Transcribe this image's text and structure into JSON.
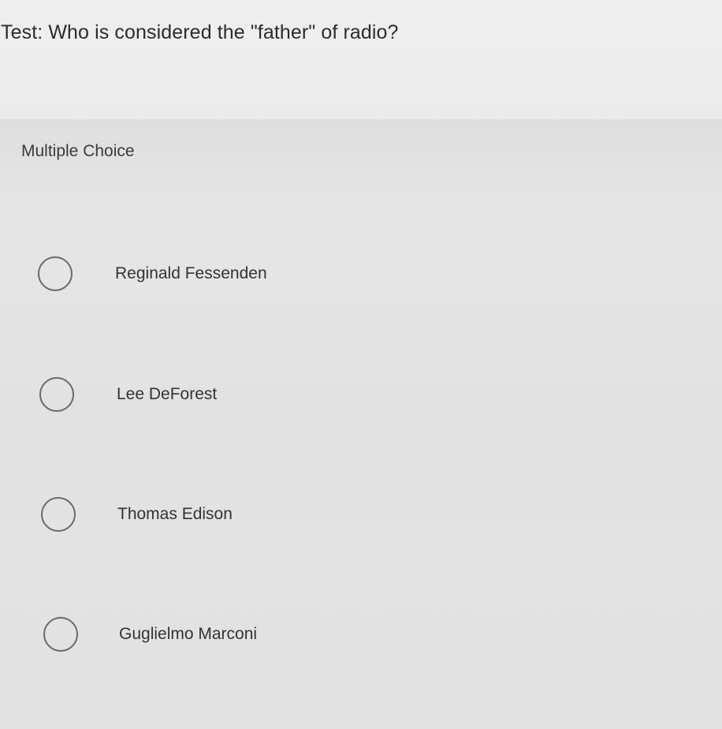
{
  "question": {
    "title": "Test: Who is considered the \"father\" of radio?"
  },
  "question_type": {
    "label": "Multiple Choice"
  },
  "choices": [
    {
      "label": "Reginald Fessenden",
      "selected": false
    },
    {
      "label": "Lee DeForest",
      "selected": false
    },
    {
      "label": "Thomas Edison",
      "selected": false
    },
    {
      "label": "Guglielmo Marconi",
      "selected": false
    }
  ]
}
